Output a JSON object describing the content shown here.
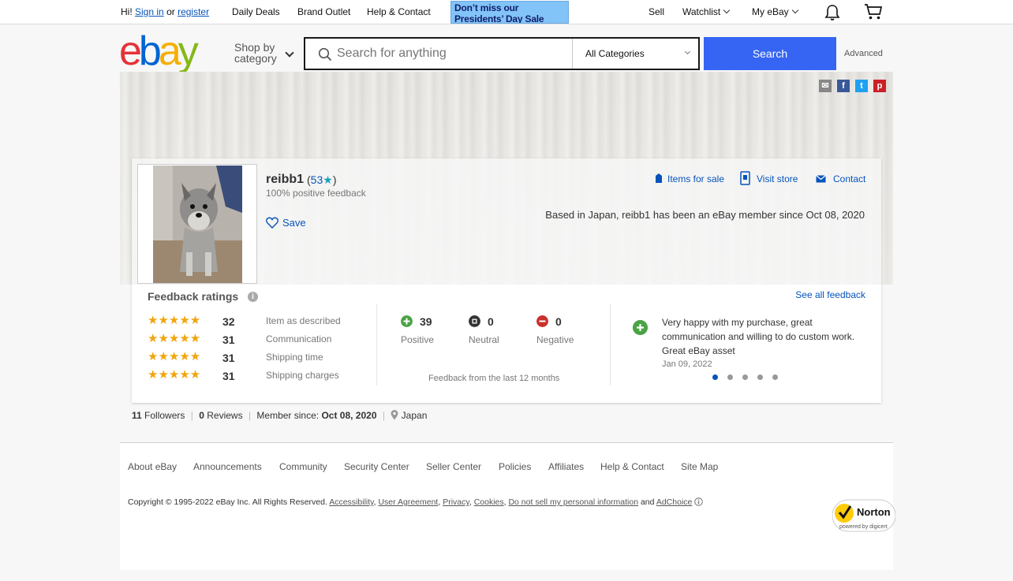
{
  "topbar": {
    "greeting": "Hi!",
    "sign_in": "Sign in",
    "or": "or",
    "register": "register",
    "daily_deals": "Daily Deals",
    "brand_outlet": "Brand Outlet",
    "help_contact": "Help & Contact",
    "promo_line1": "Don’t miss our",
    "promo_line2": "Presidents’ Day Sale",
    "sell": "Sell",
    "watchlist": "Watchlist",
    "my_ebay": "My eBay"
  },
  "header": {
    "logo": [
      "e",
      "b",
      "a",
      "y"
    ],
    "shop_by_1": "Shop by",
    "shop_by_2": "category",
    "search_placeholder": "Search for anything",
    "category": "All Categories",
    "search_button": "Search",
    "advanced": "Advanced"
  },
  "profile": {
    "username": "reibb1",
    "score": "53",
    "positive": "100% positive feedback",
    "save": "Save",
    "items_for_sale": "Items for sale",
    "visit_store": "Visit store",
    "contact": "Contact",
    "based": "Based in Japan, reibb1 has been an eBay member since Oct 08, 2020"
  },
  "feedback": {
    "title": "Feedback ratings",
    "see_all": "See all feedback",
    "ratings": [
      {
        "count": "32",
        "label": "Item as described",
        "stars": 5
      },
      {
        "count": "31",
        "label": "Communication",
        "stars": 5
      },
      {
        "count": "31",
        "label": "Shipping time",
        "stars": 5
      },
      {
        "count": "31",
        "label": "Shipping charges",
        "stars": 5
      }
    ],
    "positive": {
      "count": "39",
      "label": "Positive"
    },
    "neutral": {
      "count": "0",
      "label": "Neutral"
    },
    "negative": {
      "count": "0",
      "label": "Negative"
    },
    "last12": "Feedback from the last 12 months",
    "comment": "Very happy with my purchase, great communication and willing to do custom work. Great eBay asset",
    "comment_date": "Jan 09, 2022",
    "carousel_active": 1,
    "carousel_count": 5
  },
  "stats": {
    "followers_count": "11",
    "followers": "Followers",
    "reviews_count": "0",
    "reviews": "Reviews",
    "member_since_label": "Member since:",
    "member_since": "Oct 08, 2020",
    "location": "Japan"
  },
  "footer": {
    "links": [
      "About eBay",
      "Announcements",
      "Community",
      "Security Center",
      "Seller Center",
      "Policies",
      "Affiliates",
      "Help & Contact",
      "Site Map"
    ],
    "copyright": "Copyright © 1995-2022 eBay Inc. All Rights Reserved.",
    "accessibility": "Accessibility",
    "user_agreement": "User Agreement",
    "privacy": "Privacy",
    "cookies": "Cookies",
    "do_not_sell": "Do not sell my personal information",
    "and": "and",
    "adchoice": "AdChoice",
    "norton": "Norton",
    "norton_sub": "powered by digicert"
  },
  "colors": {
    "accent": "#3665f3",
    "link": "#0654ba",
    "star": "#f1a50c",
    "positive": "#4aa345",
    "neutral": "#333333",
    "negative": "#c8312c"
  }
}
